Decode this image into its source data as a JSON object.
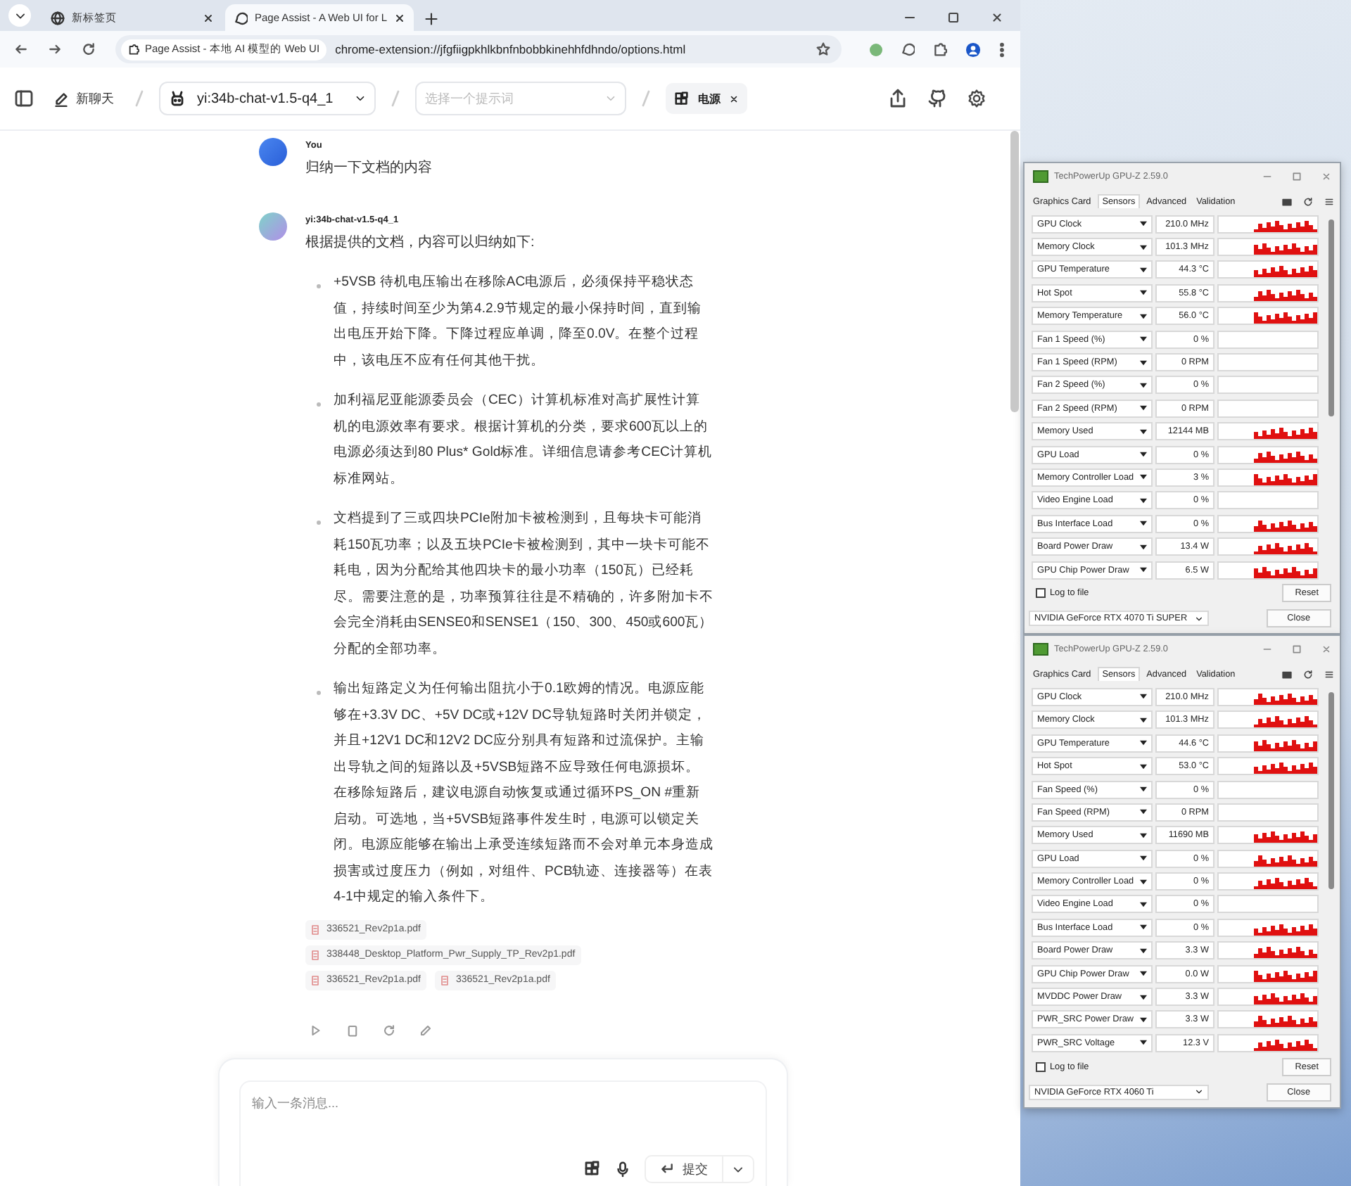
{
  "browser": {
    "tabs": [
      {
        "title": "新标签页",
        "selected": false
      },
      {
        "title": "Page Assist - A Web UI for L",
        "selected": true
      }
    ],
    "address_bar": {
      "site_chip": "Page Assist - 本地 AI 模型的 Web UI",
      "url": "chrome-extension://jfgfiigpkhlkbnfnbobbkinehhfdhndo/options.html"
    }
  },
  "app": {
    "toolbar": {
      "new_chat": "新聊天",
      "model": "yi:34b-chat-v1.5-q4_1",
      "prompt_placeholder": "选择一个提示词",
      "knowledge_chip": "电源"
    },
    "messages": [
      {
        "kind": "user",
        "sender": "You",
        "text": "归纳一下文档的内容"
      },
      {
        "kind": "assistant",
        "sender": "yi:34b-chat-v1.5-q4_1",
        "intro": "根据提供的文档，内容可以归纳如下:",
        "bullets": [
          "+5VSB 待机电压输出在移除AC电源后，必须保持平稳状态值，持续时间至少为第4.2.9节规定的最小保持时间，直到输出电压开始下降。下降过程应单调，降至0.0V。在整个过程中，该电压不应有任何其他干扰。",
          "加利福尼亚能源委员会（CEC）计算机标准对高扩展性计算机的电源效率有要求。根据计算机的分类，要求600瓦以上的电源必须达到80 Plus* Gold标准。详细信息请参考CEC计算机标准网站。",
          "文档提到了三或四块PCIe附加卡被检测到，且每块卡可能消耗150瓦功率；以及五块PCIe卡被检测到，其中一块卡可能不耗电，因为分配给其他四块卡的最小功率（150瓦）已经耗尽。需要注意的是，功率预算往往是不精确的，许多附加卡不会完全消耗由SENSE0和SENSE1（150、300、450或600瓦）分配的全部功率。",
          "输出短路定义为任何输出阻抗小于0.1欧姆的情况。电源应能够在+3.3V DC、+5V DC或+12V DC导轨短路时关闭并锁定，并且+12V1 DC和12V2 DC应分别具有短路和过流保护。主输出导轨之间的短路以及+5VSB短路不应导致任何电源损坏。在移除短路后，建议电源自动恢复或通过循环PS_ON #重新启动。可选地，当+5VSB短路事件发生时，电源可以锁定关闭。电源应能够在输出上承受连续短路而不会对单元本身造成损害或过度压力（例如，对组件、PCB轨迹、连接器等）在表4-1中规定的输入条件下。"
        ],
        "attachments": [
          "336521_Rev2p1a.pdf",
          "338448_Desktop_Platform_Pwr_Supply_TP_Rev2p1.pdf",
          "336521_Rev2p1a.pdf",
          "336521_Rev2p1a.pdf"
        ]
      }
    ],
    "composer": {
      "placeholder": "输入一条消息...",
      "submit": "提交"
    }
  },
  "gpuz_windows": [
    {
      "title": "TechPowerUp GPU-Z 2.59.0",
      "tabs": [
        {
          "label": "Graphics Card",
          "selected": false
        },
        {
          "label": "Sensors",
          "selected": true
        },
        {
          "label": "Advanced",
          "selected": false
        },
        {
          "label": "Validation",
          "selected": false
        }
      ],
      "sensors": [
        {
          "name": "GPU Clock",
          "value": "210.0 MHz",
          "graph": true
        },
        {
          "name": "Memory Clock",
          "value": "101.3 MHz",
          "graph": true
        },
        {
          "name": "GPU Temperature",
          "value": "44.3 °C",
          "graph": true
        },
        {
          "name": "Hot Spot",
          "value": "55.8 °C",
          "graph": true
        },
        {
          "name": "Memory Temperature",
          "value": "56.0 °C",
          "graph": true
        },
        {
          "name": "Fan 1 Speed (%)",
          "value": "0 %",
          "graph": false
        },
        {
          "name": "Fan 1 Speed (RPM)",
          "value": "0 RPM",
          "graph": false
        },
        {
          "name": "Fan 2 Speed (%)",
          "value": "0 %",
          "graph": false
        },
        {
          "name": "Fan 2 Speed (RPM)",
          "value": "0 RPM",
          "graph": false
        },
        {
          "name": "Memory Used",
          "value": "12144 MB",
          "graph": true
        },
        {
          "name": "GPU Load",
          "value": "0 %",
          "graph": true
        },
        {
          "name": "Memory Controller Load",
          "value": "3 %",
          "graph": true
        },
        {
          "name": "Video Engine Load",
          "value": "0 %",
          "graph": false
        },
        {
          "name": "Bus Interface Load",
          "value": "0 %",
          "graph": true
        },
        {
          "name": "Board Power Draw",
          "value": "13.4 W",
          "graph": true
        },
        {
          "name": "GPU Chip Power Draw",
          "value": "6.5 W",
          "graph": true
        }
      ],
      "log_to_file": {
        "label": "Log to file",
        "checked": false
      },
      "reset": "Reset",
      "gpu": "NVIDIA GeForce RTX 4070 Ti SUPER",
      "close": "Close"
    },
    {
      "title": "TechPowerUp GPU-Z 2.59.0",
      "tabs": [
        {
          "label": "Graphics Card",
          "selected": false
        },
        {
          "label": "Sensors",
          "selected": true
        },
        {
          "label": "Advanced",
          "selected": false
        },
        {
          "label": "Validation",
          "selected": false
        }
      ],
      "sensors": [
        {
          "name": "GPU Clock",
          "value": "210.0 MHz",
          "graph": true
        },
        {
          "name": "Memory Clock",
          "value": "101.3 MHz",
          "graph": true
        },
        {
          "name": "GPU Temperature",
          "value": "44.6 °C",
          "graph": true
        },
        {
          "name": "Hot Spot",
          "value": "53.0 °C",
          "graph": true
        },
        {
          "name": "Fan Speed (%)",
          "value": "0 %",
          "graph": false
        },
        {
          "name": "Fan Speed (RPM)",
          "value": "0 RPM",
          "graph": false
        },
        {
          "name": "Memory Used",
          "value": "11690 MB",
          "graph": true
        },
        {
          "name": "GPU Load",
          "value": "0 %",
          "graph": true
        },
        {
          "name": "Memory Controller Load",
          "value": "0 %",
          "graph": true
        },
        {
          "name": "Video Engine Load",
          "value": "0 %",
          "graph": false
        },
        {
          "name": "Bus Interface Load",
          "value": "0 %",
          "graph": true
        },
        {
          "name": "Board Power Draw",
          "value": "3.3 W",
          "graph": true
        },
        {
          "name": "GPU Chip Power Draw",
          "value": "0.0 W",
          "graph": true
        },
        {
          "name": "MVDDC Power Draw",
          "value": "3.3 W",
          "graph": true
        },
        {
          "name": "PWR_SRC Power Draw",
          "value": "3.3 W",
          "graph": true
        },
        {
          "name": "PWR_SRC Voltage",
          "value": "12.3 V",
          "graph": true
        }
      ],
      "log_to_file": {
        "label": "Log to file",
        "checked": false
      },
      "reset": "Reset",
      "gpu": "NVIDIA GeForce RTX 4060 Ti",
      "close": "Close"
    }
  ]
}
